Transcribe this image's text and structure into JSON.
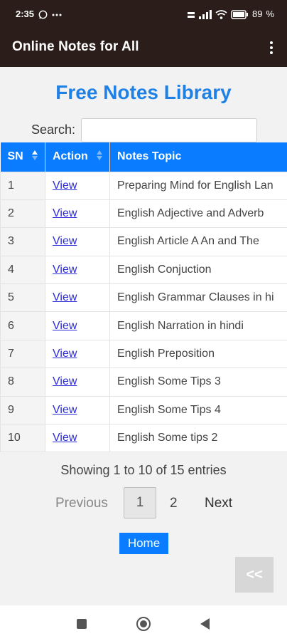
{
  "status_bar": {
    "time": "2:35",
    "icons": [
      "whatsapp-icon",
      "more-notifications-icon",
      "data-speed-icon",
      "signal-icon",
      "wifi-icon",
      "battery-icon"
    ],
    "battery": "89"
  },
  "app_bar": {
    "title": "Online Notes for All",
    "menu_icon": "overflow-menu-icon"
  },
  "main": {
    "title": "Free Notes Library",
    "search": {
      "label": "Search:",
      "value": "",
      "placeholder": ""
    },
    "table": {
      "headers": [
        "SN",
        "Action",
        "Notes Topic"
      ],
      "rows": [
        {
          "sn": "1",
          "action": "View",
          "topic": "Preparing Mind for English Lan"
        },
        {
          "sn": "2",
          "action": "View",
          "topic": "English Adjective and Adverb"
        },
        {
          "sn": "3",
          "action": "View",
          "topic": "English Article A An and The"
        },
        {
          "sn": "4",
          "action": "View",
          "topic": "English Conjuction"
        },
        {
          "sn": "5",
          "action": "View",
          "topic": "English Grammar Clauses in hi"
        },
        {
          "sn": "6",
          "action": "View",
          "topic": "English Narration in hindi"
        },
        {
          "sn": "7",
          "action": "View",
          "topic": "English Preposition"
        },
        {
          "sn": "8",
          "action": "View",
          "topic": "English Some Tips 3"
        },
        {
          "sn": "9",
          "action": "View",
          "topic": "English Some Tips 4"
        },
        {
          "sn": "10",
          "action": "View",
          "topic": "English Some tips 2"
        }
      ]
    },
    "entries_info": "Showing 1 to 10 of 15 entries",
    "pagination": {
      "previous": "Previous",
      "pages": [
        "1",
        "2"
      ],
      "next": "Next"
    },
    "home_button": "Home",
    "back_button": "<<"
  },
  "nav_bar": {
    "icons": [
      "recents-square-icon",
      "home-circle-icon",
      "back-triangle-icon"
    ]
  },
  "colors": {
    "app_bar": "#2b1d19",
    "accent": "#0a7cff",
    "title": "#1f80e6"
  }
}
